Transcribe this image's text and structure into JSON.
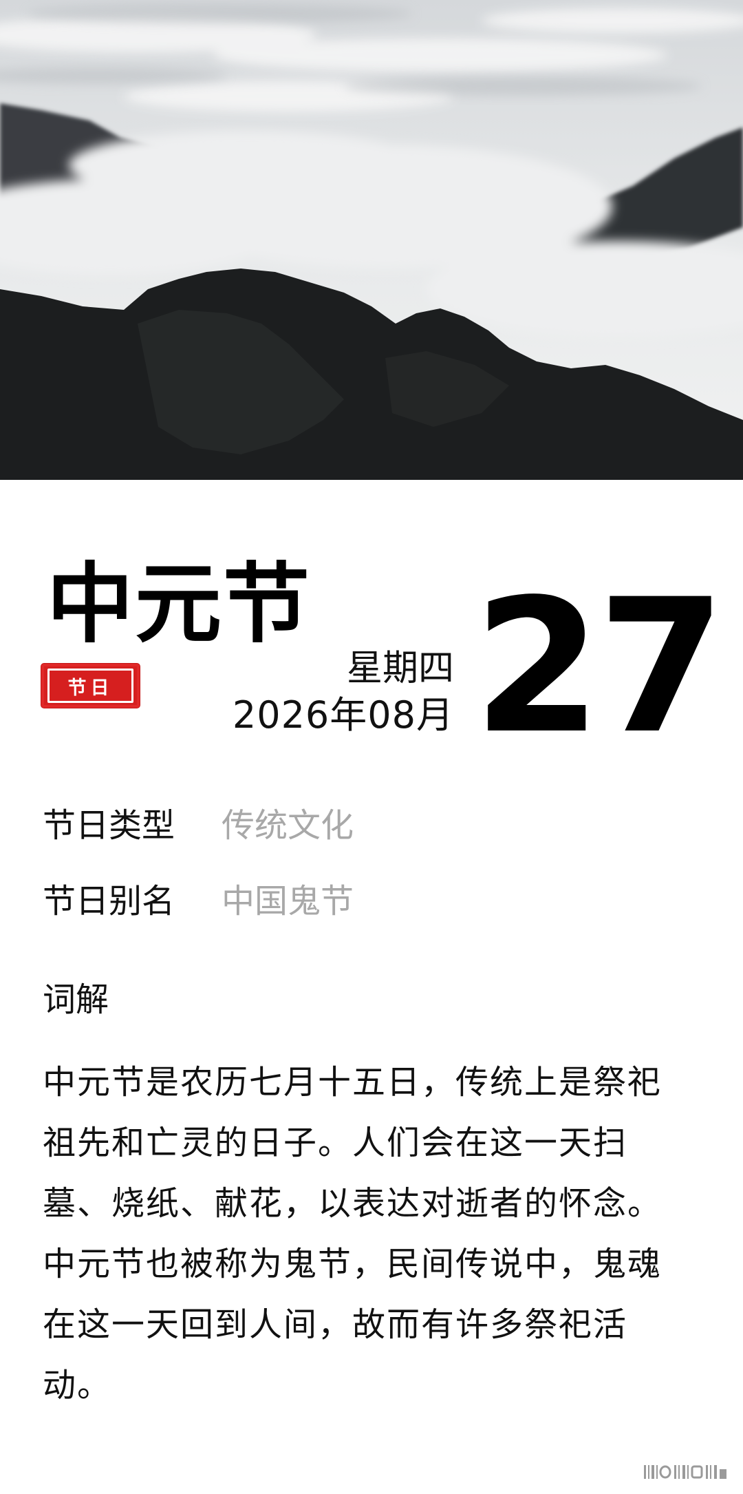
{
  "festival": {
    "name": "中元节",
    "seal_label": "节日",
    "seal_color": "#d61f1f",
    "weekday": "星期四",
    "year_month": "2026年08月",
    "day": "27"
  },
  "info": {
    "type_label": "节日类型",
    "type_value": "传统文化",
    "alias_label": "节日别名",
    "alias_value": "中国鬼节"
  },
  "explanation": {
    "heading": "词解",
    "lines": [
      "中元节是农历七月十五日，传统上是祭祀",
      "祖先和亡灵的日子。人们会在这一天扫",
      "墓、烧纸、献花，以表达对逝者的怀念。",
      "中元节也被称为鬼节，民间传说中，鬼魂",
      "在这一天回到人间，故而有许多祭祀活",
      "动。"
    ]
  },
  "hero": {
    "icon": "mountain-clouds-landscape"
  }
}
